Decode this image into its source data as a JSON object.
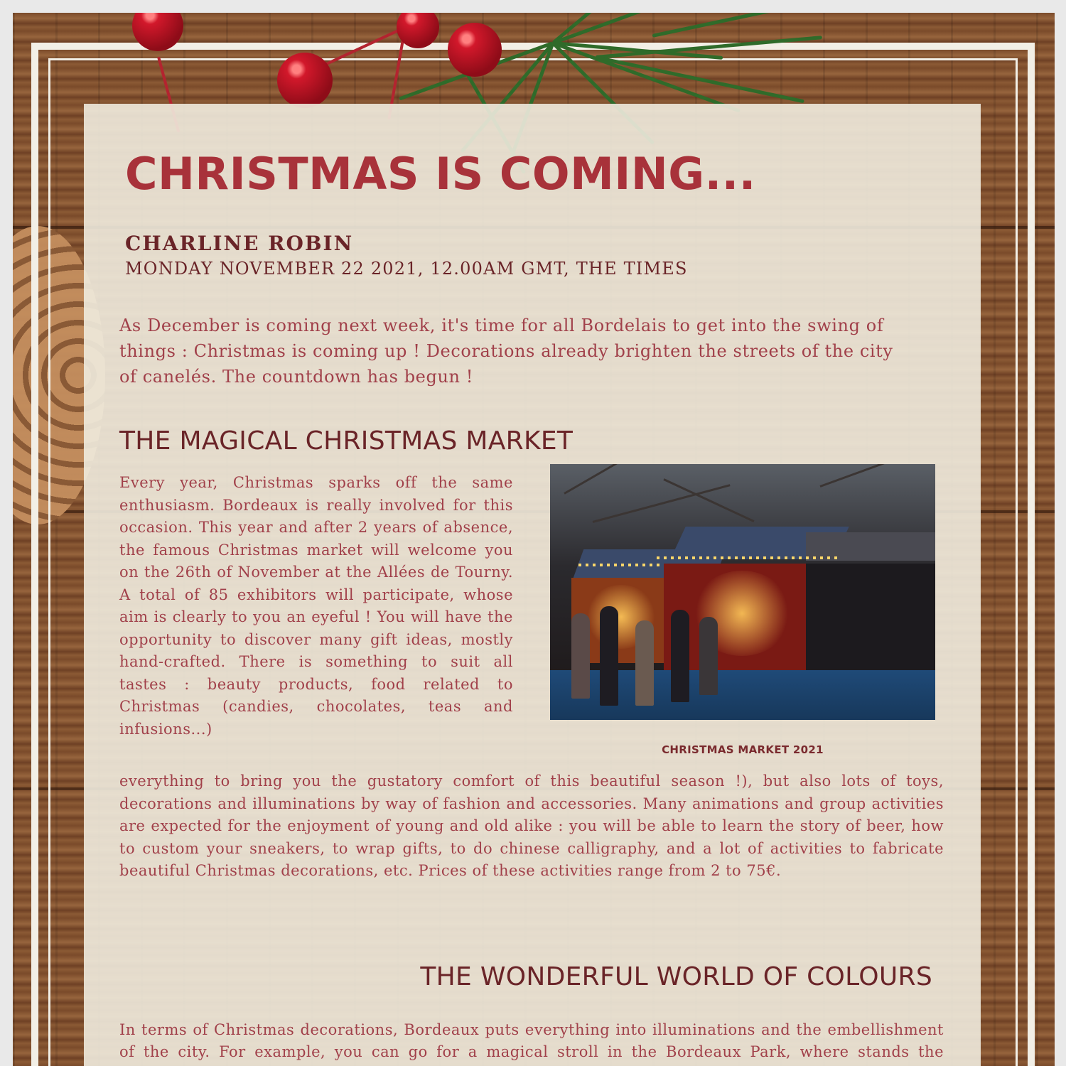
{
  "article": {
    "title": "CHRISTMAS IS COMING...",
    "author": "CHARLINE ROBIN",
    "dateline": "MONDAY NOVEMBER 22 2021, 12.00AM GMT, THE TIMES",
    "lead": "As December is coming next week, it's time for all Bordelais to get into the swing of things : Christmas is coming up ! Decorations already brighten the streets of the city of canelés. The countdown has begun !"
  },
  "section1": {
    "heading": "THE MAGICAL CHRISTMAS MARKET",
    "column_text": "Every year, Christmas sparks off the same enthusiasm. Bordeaux is really involved for this occasion. This year and after 2 years of absence, the famous Christmas market will welcome you on the 26th of November at the Allées de Tourny. A total of 85 exhibitors will participate, whose aim is clearly to you an eyeful ! You will have the opportunity to discover many gift ideas, mostly hand-crafted. There is something to suit all tastes : beauty products, food related to Christmas (candies, chocolates, teas and infusions...)",
    "continued_text": "everything to bring you the gustatory comfort of this beautiful season !), but also lots of toys, decorations and illuminations by way of fashion and accessories. Many animations and group activities are expected for the enjoyment of young and old alike : you will be able to learn the story of beer, how to custom your sneakers, to wrap gifts, to do chinese calligraphy, and a lot of activities to fabricate beautiful Christmas decorations, etc. Prices of these activities range from 2 to 75€.",
    "photo_caption": "CHRISTMAS MARKET 2021"
  },
  "section2": {
    "heading": "THE WONDERFUL WORLD OF COLOURS",
    "text": "In terms of Christmas decorations, Bordeaux puts everything into illuminations and the embellishment of the city. For example, you can go for a magical stroll in the Bordeaux Park, where stands the Wonderful World of Colours. Reconnect with your inner child"
  },
  "colors": {
    "title_red": "#a8323a",
    "heading_brown": "#6a2428",
    "body_rose": "#a1404a",
    "panel_cream": "#f0ebde",
    "wood_brown": "#7a4a2a"
  }
}
